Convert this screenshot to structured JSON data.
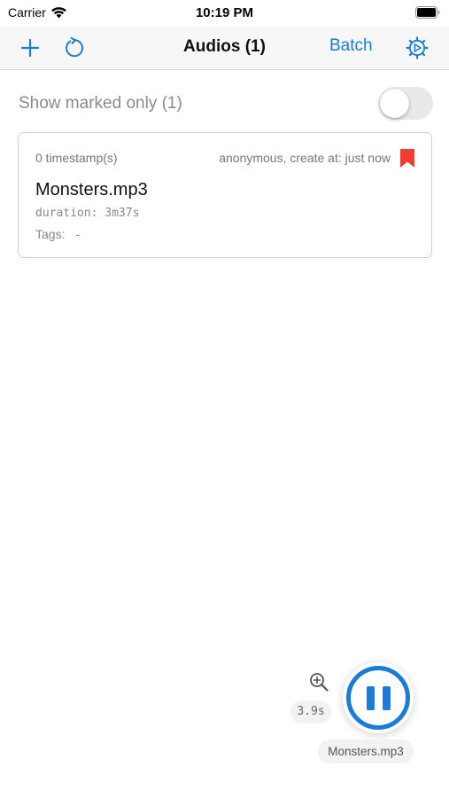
{
  "status_bar": {
    "carrier": "Carrier",
    "time": "10:19 PM"
  },
  "navbar": {
    "title": "Audios (1)",
    "batch_label": "Batch",
    "accent_color": "#1a7bd8"
  },
  "filter": {
    "label": "Show marked only (1)",
    "enabled": false
  },
  "audio_list": [
    {
      "timestamps": "0 timestamp(s)",
      "meta": "anonymous, create at: just now",
      "title": "Monsters.mp3",
      "duration": "duration: 3m37s",
      "tags_label": "Tags:",
      "tags_value": "-",
      "marked": true,
      "bookmark_color": "#f23c2f"
    }
  ],
  "player": {
    "speed": "3.9s",
    "filename": "Monsters.mp3",
    "state": "playing"
  },
  "icons": [
    "wifi-icon",
    "battery-icon",
    "plus-icon",
    "refresh-icon",
    "gear-icon",
    "bookmark-icon",
    "zoom-in-icon",
    "pause-icon"
  ]
}
